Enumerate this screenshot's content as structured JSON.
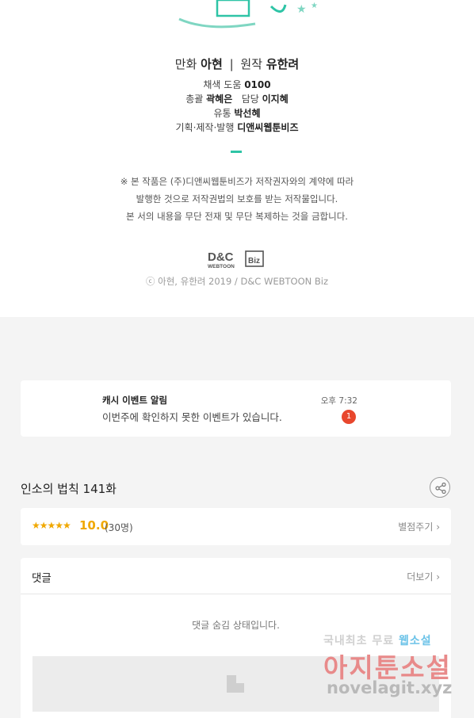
{
  "credits": {
    "author_prefix": "만화",
    "artist": "아현",
    "separator": "|",
    "original_prefix": "원작",
    "writer": "유한려",
    "coloring_label": "채색 도움",
    "coloring_value": "0100",
    "director_label": "총괄",
    "director_value": "곽혜은",
    "manager_label": "담당",
    "manager_value": "이지혜",
    "distribution_label": "유통",
    "distribution_value": "박선혜",
    "production_label": "기획·제작·발행",
    "production_value": "디앤씨웹툰비즈",
    "notice_line1": "※ 본 작품은 (주)디앤씨웹툰비즈가 저작권자와의 계약에 따라",
    "notice_line2": "발행한 것으로 저작권법의 보호를 받는 저작물입니다.",
    "notice_line3": "본 서의 내용을 무단 전재 및 무단 복제하는 것을 금합니다.",
    "copyright": "ⓒ 아현, 유한려 2019 / D&C WEBTOON Biz",
    "logo_main": "D&C",
    "logo_sub": "WEBTOON",
    "logo_biz": "Biz"
  },
  "event": {
    "title": "캐시 이벤트 알림",
    "description": "이번주에 확인하지 못한 이벤트가 있습니다.",
    "time": "오후 7:32",
    "badge": "1"
  },
  "episode": {
    "title": "인소의 법칙 141화",
    "share_icon": "share-icon"
  },
  "rating": {
    "stars": "★★★★★",
    "score": "10.0",
    "count": "(30명)",
    "rate_link": "별점주기 ›"
  },
  "comments": {
    "label": "댓글",
    "more_link": "더보기 ›",
    "hidden_text": "댓글 숨김 상태입니다."
  },
  "watermark": {
    "top_a": "국내최초 무료",
    "top_b": "웹소설",
    "middle": "아지툰소설",
    "bottom": "novelagit.xyz"
  },
  "colors": {
    "accent_teal": "#2ec4a6",
    "star_gold": "#f0a800",
    "badge_red": "#e8472d",
    "page_bg": "#f4f4f4"
  }
}
